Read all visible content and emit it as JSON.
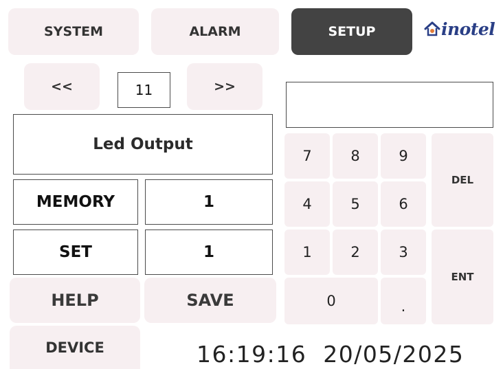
{
  "nav": {
    "system_label": "SYSTEM",
    "alarm_label": "ALARM",
    "setup_label": "SETUP",
    "active_tab": "SETUP"
  },
  "brand": {
    "logo_text": "inotel"
  },
  "pager": {
    "prev_label": "<<",
    "next_label": ">>",
    "page": "11"
  },
  "parameter": {
    "name": "Led Output",
    "memory_label": "MEMORY",
    "memory_value": "1",
    "set_label": "SET",
    "set_value": "1"
  },
  "actions": {
    "help_label": "HELP",
    "save_label": "SAVE",
    "device_label": "DEVICE"
  },
  "keypad": {
    "display_value": "",
    "keys": [
      "7",
      "8",
      "9",
      "4",
      "5",
      "6",
      "1",
      "2",
      "3",
      "0",
      "."
    ],
    "del_label": "DEL",
    "ent_label": "ENT"
  },
  "status": {
    "time": "16:19:16",
    "date": "20/05/2025"
  },
  "colors": {
    "button_bg": "#f7eff1",
    "active_bg": "#434343",
    "logo": "#2a3f86",
    "logo_accent": "#e07b39"
  }
}
